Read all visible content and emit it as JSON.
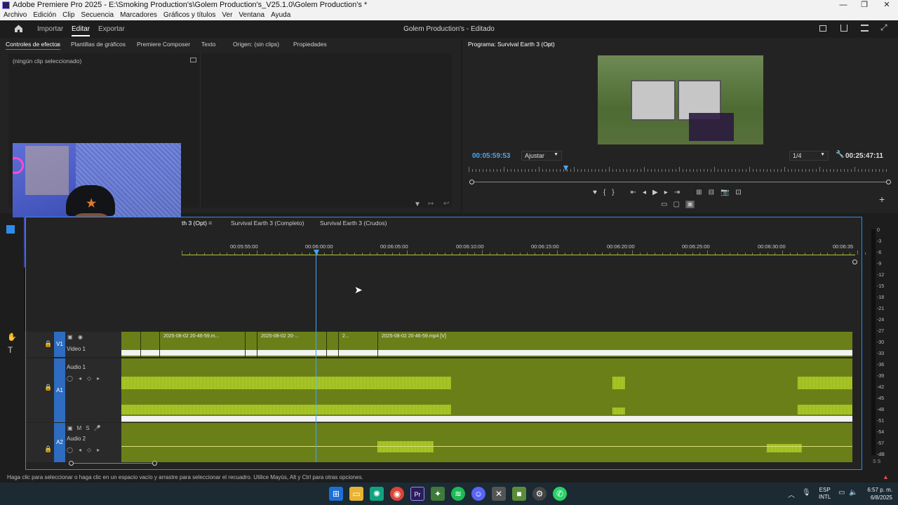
{
  "window": {
    "title": "Adobe Premiere Pro 2025 - E:\\Smoking Production's\\Golem Production's_V25.1.0\\Golem Production's *",
    "controls": [
      "—",
      "❐",
      "✕"
    ]
  },
  "menu": [
    "Archivo",
    "Edición",
    "Clip",
    "Secuencia",
    "Marcadores",
    "Gráficos y títulos",
    "Ver",
    "Ventana",
    "Ayuda"
  ],
  "header": {
    "tabs": [
      "Importar",
      "Editar",
      "Exportar"
    ],
    "active_tab": "Editar",
    "project_title": "Golem Production's - Editado"
  },
  "source_panel": {
    "tabs": [
      "Controles de efectos",
      "Plantillas de gráficos",
      "Premiere Composer",
      "Texto",
      "Origen: (sin clips)",
      "Propiedades"
    ],
    "empty_message": "(ningún clip seleccionado)"
  },
  "program_monitor": {
    "title": "Programa: Survival Earth 3 (Opt)",
    "timecode_current": "00:05:59:53",
    "fit_label": "Ajustar",
    "resolution": "1/4",
    "timecode_duration": "00:25:47:11",
    "playhead_fraction": 0.23,
    "buttons": [
      "♥",
      "{",
      "}",
      "⇤",
      "◂",
      "▶",
      "▸",
      "⇥",
      "⊞",
      "⊟",
      "📷",
      "⊡"
    ],
    "bottom_buttons": [
      "▭",
      "▢",
      "▣"
    ],
    "add_icon": "+"
  },
  "timeline": {
    "tabs": [
      "th 3 (Opt)",
      "Survival Earth 3 (Completo)",
      "Survival Earth 3 (Crudos)"
    ],
    "ruler": [
      "00:05:55:00",
      "00:06:00:00",
      "00:06:05:00",
      "00:06:10:00",
      "00:06:15:00",
      "00:06:20:00",
      "00:06:25:00",
      "00:06:30:00",
      "00:06:35"
    ],
    "tracks": {
      "v1": {
        "id": "V1",
        "name": "Video 1"
      },
      "a1": {
        "id": "A1",
        "name": "Audio 1"
      },
      "a2": {
        "id": "A2",
        "name": "Audio 2"
      }
    },
    "clips": [
      "2025-08-02 20-46-59.m...",
      "2025-08-02 20-...",
      "2...",
      "2025-08-02 20-46-59.mp4 [V]"
    ]
  },
  "meter": {
    "labels": [
      "0",
      "-3",
      "-6",
      "-9",
      "-12",
      "-15",
      "-18",
      "-21",
      "-24",
      "-27",
      "-30",
      "-33",
      "-36",
      "-39",
      "-42",
      "-45",
      "-48",
      "-51",
      "-54",
      "-57",
      "-dB"
    ],
    "footer": "S S"
  },
  "status_bar": {
    "text": "Haga clic para seleccionar o haga clic en un espacio vacío y arrastre para seleccionar el recuadro. Utilice Mayús, Alt y Ctrl para otras opciones."
  },
  "taskbar": {
    "apps": [
      "windows-start",
      "file-explorer",
      "chatgpt",
      "chrome",
      "premiere",
      "game-app",
      "spotify",
      "discord",
      "vmware",
      "minecraft",
      "settings",
      "whatsapp"
    ],
    "lang": "ESP",
    "lang2": "INTL",
    "time": "6:57 p. m.",
    "date": "6/8/2025"
  },
  "colors": {
    "accent": "#2d8ceb",
    "clip_green": "#6b7f19",
    "wave_green": "#b5d32a",
    "timecode_blue": "#4aa3f5"
  }
}
